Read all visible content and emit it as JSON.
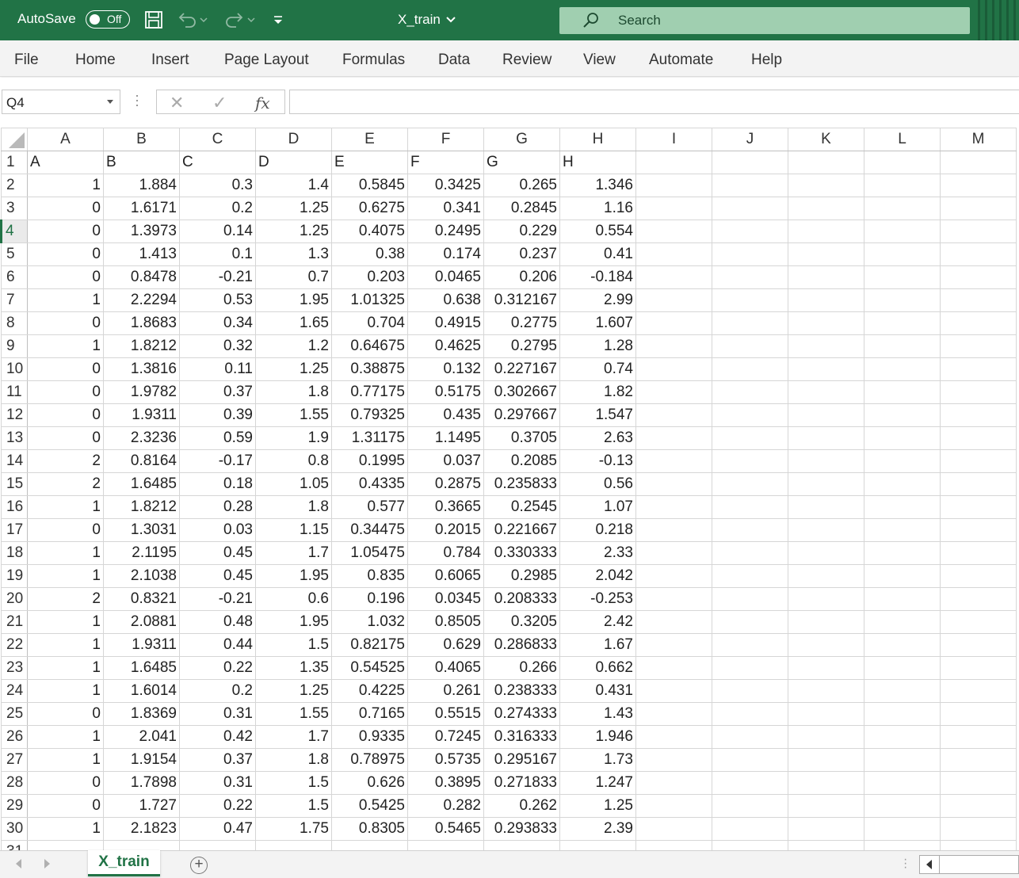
{
  "titlebar": {
    "autosave_label": "AutoSave",
    "autosave_state": "Off",
    "file_name": "X_train",
    "search_placeholder": "Search",
    "accent_color": "#217346"
  },
  "menu": [
    "File",
    "Home",
    "Insert",
    "Page Layout",
    "Formulas",
    "Data",
    "Review",
    "View",
    "Automate",
    "Help"
  ],
  "formula_bar": {
    "name_box": "Q4",
    "fx_label": "fx",
    "formula": ""
  },
  "columns": [
    "A",
    "B",
    "C",
    "D",
    "E",
    "F",
    "G",
    "H",
    "I",
    "J",
    "K",
    "L",
    "M"
  ],
  "active_row": "4",
  "header_row": [
    "A",
    "B",
    "C",
    "D",
    "E",
    "F",
    "G",
    "H"
  ],
  "rows": [
    [
      "1",
      "1.884",
      "0.3",
      "1.4",
      "0.5845",
      "0.3425",
      "0.265",
      "1.346"
    ],
    [
      "0",
      "1.6171",
      "0.2",
      "1.25",
      "0.6275",
      "0.341",
      "0.2845",
      "1.16"
    ],
    [
      "0",
      "1.3973",
      "0.14",
      "1.25",
      "0.4075",
      "0.2495",
      "0.229",
      "0.554"
    ],
    [
      "0",
      "1.413",
      "0.1",
      "1.3",
      "0.38",
      "0.174",
      "0.237",
      "0.41"
    ],
    [
      "0",
      "0.8478",
      "-0.21",
      "0.7",
      "0.203",
      "0.0465",
      "0.206",
      "-0.184"
    ],
    [
      "1",
      "2.2294",
      "0.53",
      "1.95",
      "1.01325",
      "0.638",
      "0.312167",
      "2.99"
    ],
    [
      "0",
      "1.8683",
      "0.34",
      "1.65",
      "0.704",
      "0.4915",
      "0.2775",
      "1.607"
    ],
    [
      "1",
      "1.8212",
      "0.32",
      "1.2",
      "0.64675",
      "0.4625",
      "0.2795",
      "1.28"
    ],
    [
      "0",
      "1.3816",
      "0.11",
      "1.25",
      "0.38875",
      "0.132",
      "0.227167",
      "0.74"
    ],
    [
      "0",
      "1.9782",
      "0.37",
      "1.8",
      "0.77175",
      "0.5175",
      "0.302667",
      "1.82"
    ],
    [
      "0",
      "1.9311",
      "0.39",
      "1.55",
      "0.79325",
      "0.435",
      "0.297667",
      "1.547"
    ],
    [
      "0",
      "2.3236",
      "0.59",
      "1.9",
      "1.31175",
      "1.1495",
      "0.3705",
      "2.63"
    ],
    [
      "2",
      "0.8164",
      "-0.17",
      "0.8",
      "0.1995",
      "0.037",
      "0.2085",
      "-0.13"
    ],
    [
      "2",
      "1.6485",
      "0.18",
      "1.05",
      "0.4335",
      "0.2875",
      "0.235833",
      "0.56"
    ],
    [
      "1",
      "1.8212",
      "0.28",
      "1.8",
      "0.577",
      "0.3665",
      "0.2545",
      "1.07"
    ],
    [
      "0",
      "1.3031",
      "0.03",
      "1.15",
      "0.34475",
      "0.2015",
      "0.221667",
      "0.218"
    ],
    [
      "1",
      "2.1195",
      "0.45",
      "1.7",
      "1.05475",
      "0.784",
      "0.330333",
      "2.33"
    ],
    [
      "1",
      "2.1038",
      "0.45",
      "1.95",
      "0.835",
      "0.6065",
      "0.2985",
      "2.042"
    ],
    [
      "2",
      "0.8321",
      "-0.21",
      "0.6",
      "0.196",
      "0.0345",
      "0.208333",
      "-0.253"
    ],
    [
      "1",
      "2.0881",
      "0.48",
      "1.95",
      "1.032",
      "0.8505",
      "0.3205",
      "2.42"
    ],
    [
      "1",
      "1.9311",
      "0.44",
      "1.5",
      "0.82175",
      "0.629",
      "0.286833",
      "1.67"
    ],
    [
      "1",
      "1.6485",
      "0.22",
      "1.35",
      "0.54525",
      "0.4065",
      "0.266",
      "0.662"
    ],
    [
      "1",
      "1.6014",
      "0.2",
      "1.25",
      "0.4225",
      "0.261",
      "0.238333",
      "0.431"
    ],
    [
      "0",
      "1.8369",
      "0.31",
      "1.55",
      "0.7165",
      "0.5515",
      "0.274333",
      "1.43"
    ],
    [
      "1",
      "2.041",
      "0.42",
      "1.7",
      "0.9335",
      "0.7245",
      "0.316333",
      "1.946"
    ],
    [
      "1",
      "1.9154",
      "0.37",
      "1.8",
      "0.78975",
      "0.5735",
      "0.295167",
      "1.73"
    ],
    [
      "0",
      "1.7898",
      "0.31",
      "1.5",
      "0.626",
      "0.3895",
      "0.271833",
      "1.247"
    ],
    [
      "0",
      "1.727",
      "0.22",
      "1.5",
      "0.5425",
      "0.282",
      "0.262",
      "1.25"
    ],
    [
      "1",
      "2.1823",
      "0.47",
      "1.75",
      "0.8305",
      "0.5465",
      "0.293833",
      "2.39"
    ]
  ],
  "sheet_tabs": [
    "X_train"
  ],
  "add_sheet_symbol": "+"
}
